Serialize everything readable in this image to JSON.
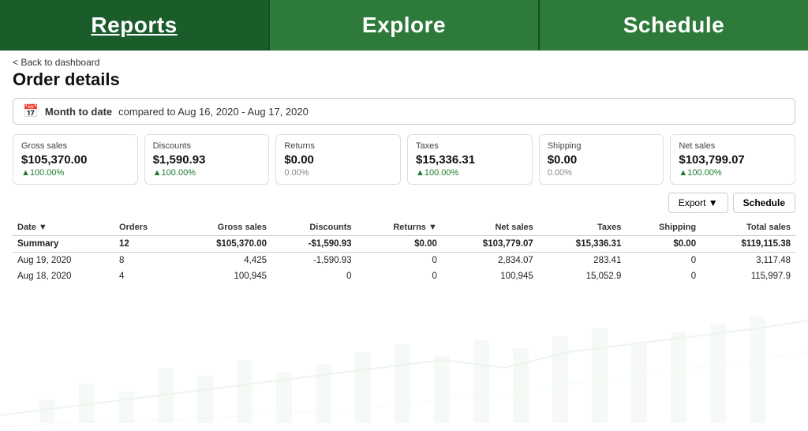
{
  "nav": {
    "items": [
      {
        "label": "Reports",
        "active": true
      },
      {
        "label": "Explore",
        "active": false
      },
      {
        "label": "Schedule",
        "active": false
      }
    ]
  },
  "breadcrumb": "< Back to dashboard",
  "page_title": "Order details",
  "date_filter": {
    "period_label": "Month to date",
    "comparison_text": "compared to Aug 16, 2020 - Aug 17, 2020"
  },
  "metrics": [
    {
      "label": "Gross sales",
      "value": "$105,370.00",
      "change": "▲100.00%",
      "up": true
    },
    {
      "label": "Discounts",
      "value": "$1,590.93",
      "change": "▲100.00%",
      "up": true
    },
    {
      "label": "Returns",
      "value": "$0.00",
      "change": "0.00%",
      "up": false
    },
    {
      "label": "Taxes",
      "value": "$15,336.31",
      "change": "▲100.00%",
      "up": true
    },
    {
      "label": "Shipping",
      "value": "$0.00",
      "change": "0.00%",
      "up": false
    },
    {
      "label": "Net sales",
      "value": "$103,799.07",
      "change": "▲100.00%",
      "up": true
    }
  ],
  "buttons": {
    "export": "Export ▼",
    "schedule": "Schedule"
  },
  "table": {
    "headers": [
      {
        "label": "Date ▼",
        "sortable": true
      },
      {
        "label": "Orders",
        "sortable": false
      },
      {
        "label": "Gross sales",
        "sortable": false
      },
      {
        "label": "Discounts",
        "sortable": false
      },
      {
        "label": "Returns ▼",
        "sortable": true
      },
      {
        "label": "Net sales",
        "sortable": false
      },
      {
        "label": "Taxes",
        "sortable": false
      },
      {
        "label": "Shipping",
        "sortable": false
      },
      {
        "label": "Total sales",
        "sortable": false
      }
    ],
    "rows": [
      {
        "date": "Summary",
        "orders": "12",
        "gross_sales": "$105,370.00",
        "discounts": "-$1,590.93",
        "returns": "$0.00",
        "net_sales": "$103,779.07",
        "taxes": "$15,336.31",
        "shipping": "$0.00",
        "total_sales": "$119,115.38",
        "summary": true
      },
      {
        "date": "Aug 19, 2020",
        "orders": "8",
        "gross_sales": "4,425",
        "discounts": "-1,590.93",
        "returns": "0",
        "net_sales": "2,834.07",
        "taxes": "283.41",
        "shipping": "0",
        "total_sales": "3,117.48",
        "summary": false
      },
      {
        "date": "Aug 18, 2020",
        "orders": "4",
        "gross_sales": "100,945",
        "discounts": "0",
        "returns": "0",
        "net_sales": "100,945",
        "taxes": "15,052.9",
        "shipping": "0",
        "total_sales": "115,997.9",
        "summary": false
      }
    ]
  }
}
